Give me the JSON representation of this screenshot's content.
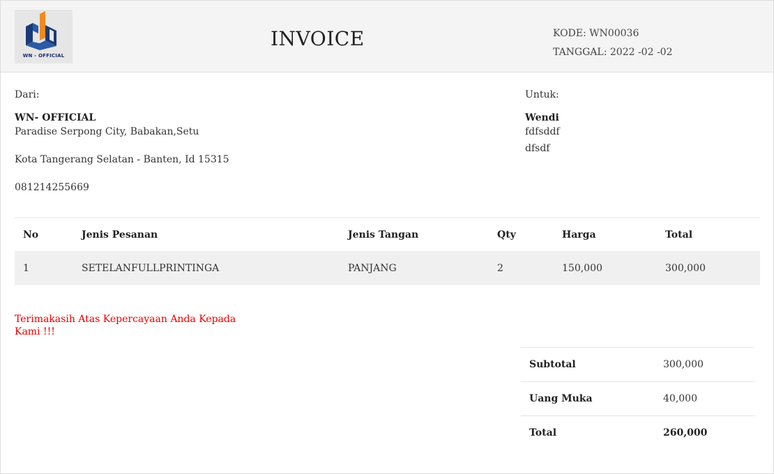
{
  "header": {
    "logo_text": "WN - OFFICIAL",
    "title": "INVOICE",
    "kode": "KODE: WN00036",
    "tanggal": "TANGGAL: 2022 -02 -02"
  },
  "from": {
    "label": "Dari:",
    "name": "WN- OFFICIAL",
    "address1": "Paradise  Serpong  City, Babakan,Setu",
    "address2": "Kota Tangerang   Selatan  - Banten,  Id 15315",
    "phone": "081214255669"
  },
  "to": {
    "label": "Untuk:",
    "name": "Wendi",
    "line1": "fdfsddf",
    "line2": "dfsdf"
  },
  "items": {
    "headers": [
      "No",
      "Jenis Pesanan",
      "Jenis Tangan",
      "Qty",
      "Harga",
      "Total"
    ],
    "rows": [
      [
        "1",
        "SETELANFULLPRINTINGA",
        "PANJANG",
        "2",
        "150,000",
        "300,000"
      ]
    ]
  },
  "thanks": "Terimakasih   Atas  Kepercayaan  Anda  Kepada  Kami !!!",
  "totals": {
    "subtotal_label": "Subtotal",
    "subtotal_value": "300,000",
    "dp_label": "Uang  Muka",
    "dp_value": "40,000",
    "total_label": "Total",
    "total_value": "260,000"
  },
  "colors": {
    "accent_text": "#e60000",
    "logo_blue": "#1b2a6b",
    "logo_orange": "#f08a1c"
  }
}
